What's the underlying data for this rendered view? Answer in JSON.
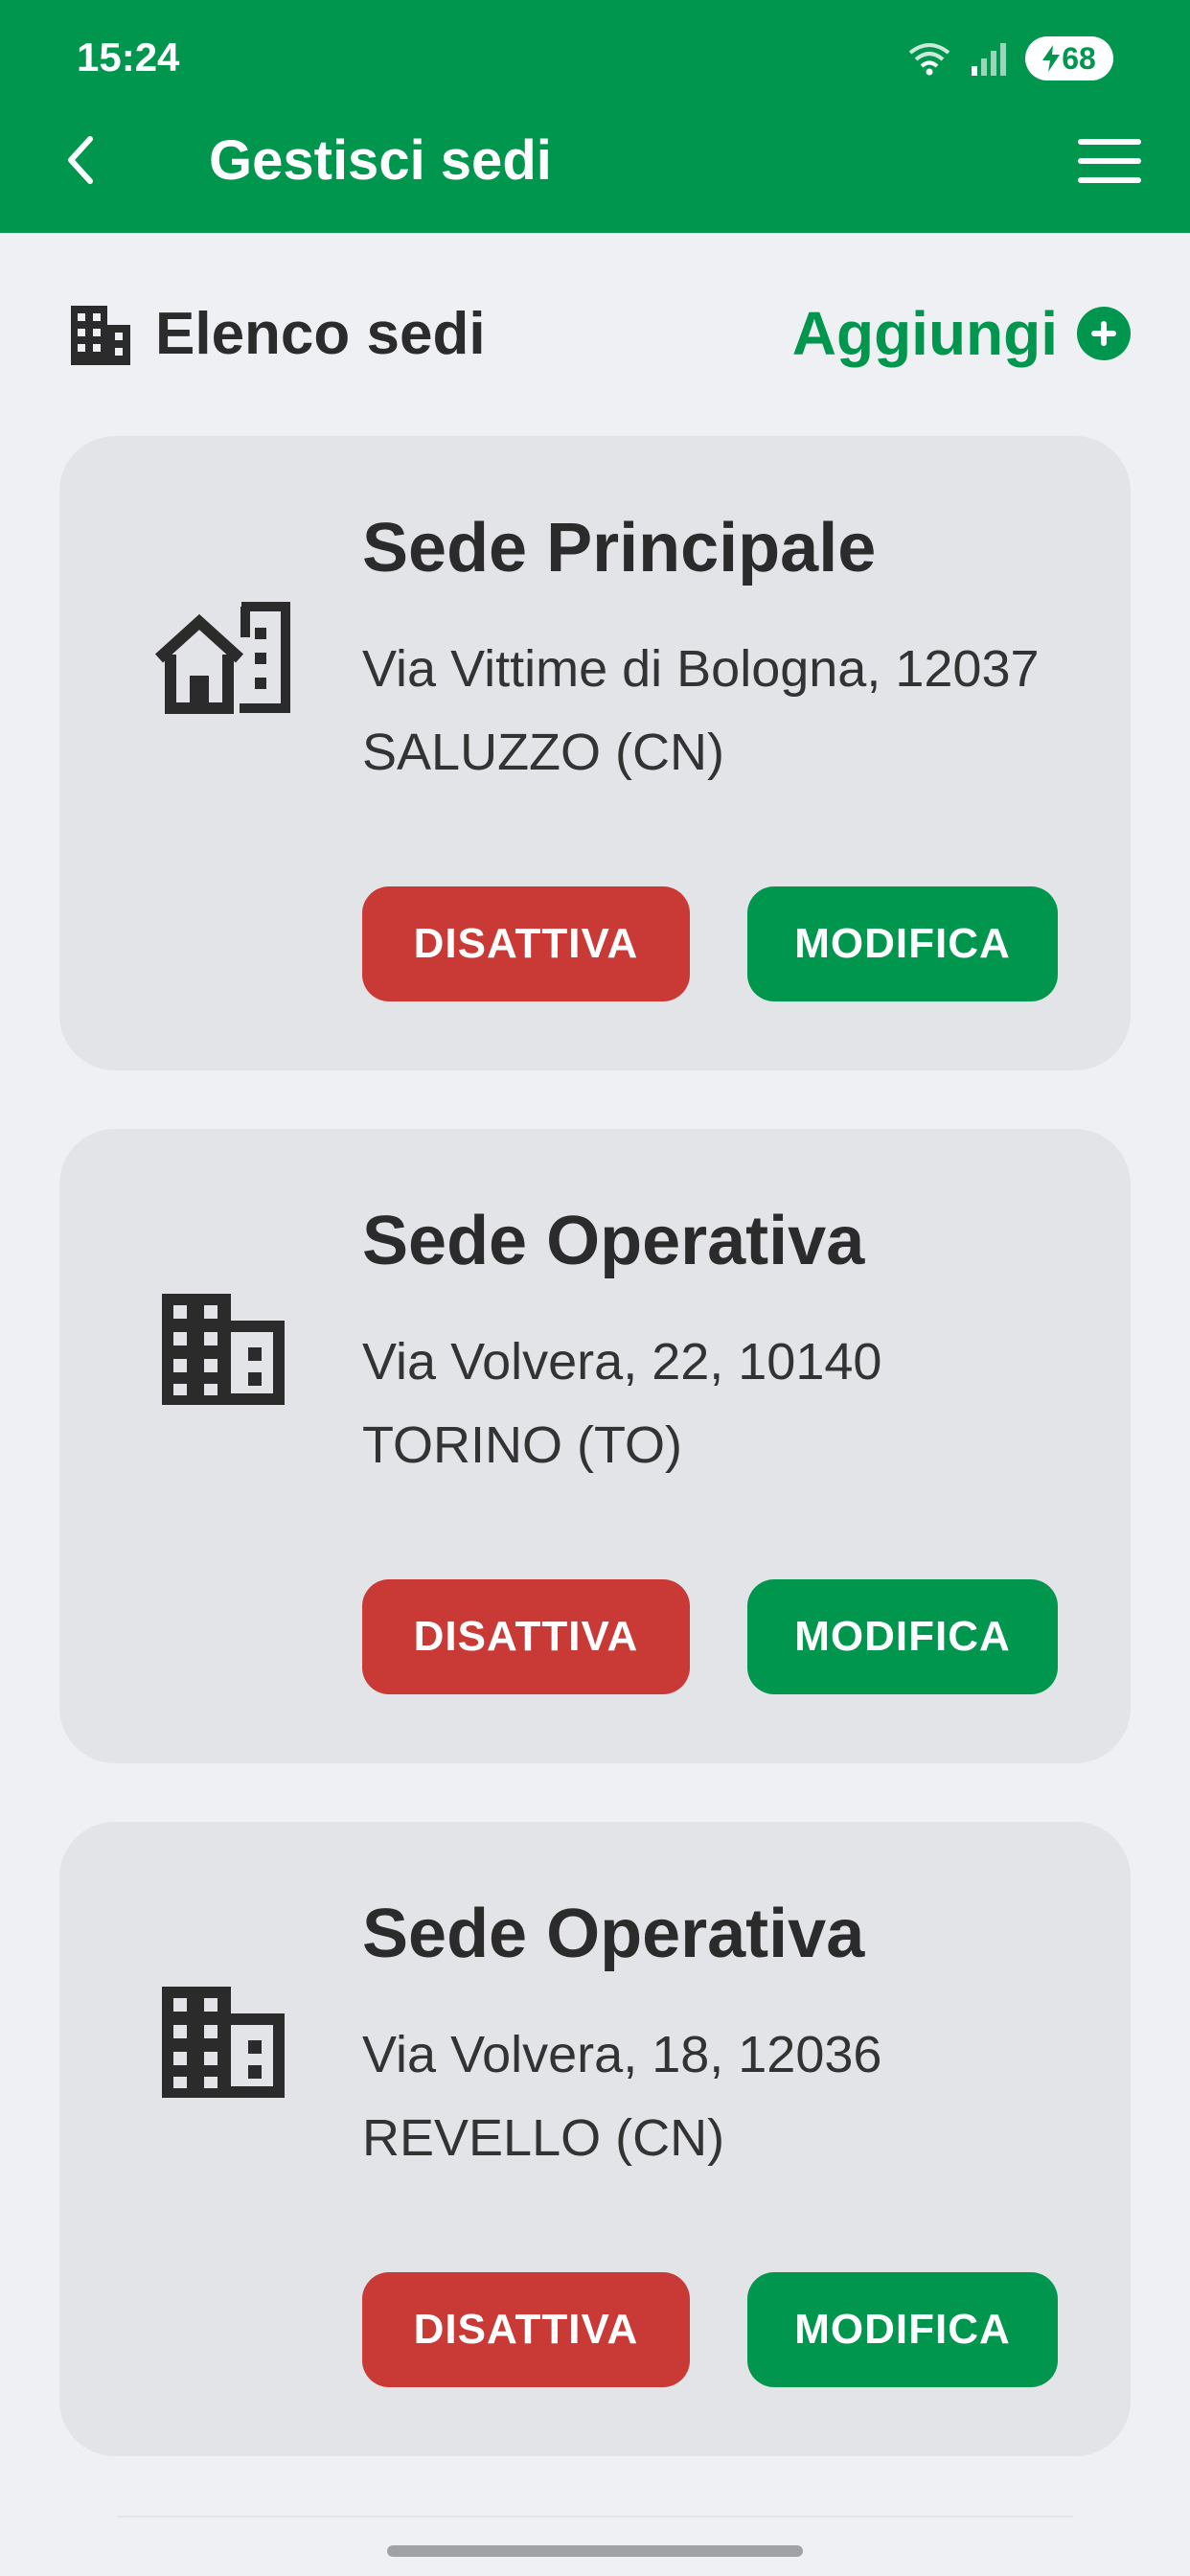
{
  "status_bar": {
    "time": "15:24",
    "battery_level": "68"
  },
  "header": {
    "title": "Gestisci sedi"
  },
  "section": {
    "title": "Elenco sedi",
    "add_label": "Aggiungi"
  },
  "sites": [
    {
      "name": "Sede Principale",
      "address": "Via Vittime di Bologna, 12037 SALUZZO (CN)",
      "icon": "house-building-icon",
      "deactivate_label": "DISATTIVA",
      "edit_label": "MODIFICA"
    },
    {
      "name": "Sede Operativa",
      "address": "Via Volvera, 22, 10140 TORINO (TO)",
      "icon": "office-building-icon",
      "deactivate_label": "DISATTIVA",
      "edit_label": "MODIFICA"
    },
    {
      "name": "Sede Operativa",
      "address": "Via Volvera, 18, 12036 REVELLO (CN)",
      "icon": "office-building-icon",
      "deactivate_label": "DISATTIVA",
      "edit_label": "MODIFICA"
    }
  ],
  "colors": {
    "primary": "#00964e",
    "danger": "#c93a36",
    "card": "#e3e4e7",
    "background": "#eef0f3"
  }
}
